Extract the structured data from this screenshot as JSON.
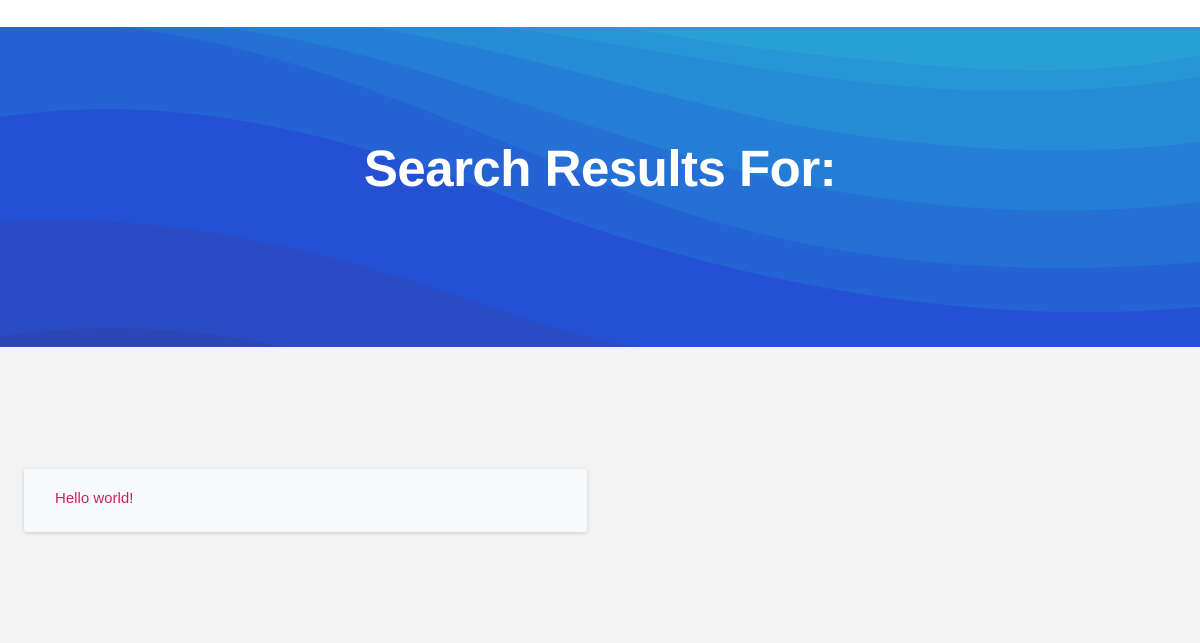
{
  "hero": {
    "title": "Search Results For:"
  },
  "results": [
    {
      "title": "Hello world!"
    }
  ],
  "colors": {
    "hero_primary": "#2451d3",
    "hero_light": "#28a0d6",
    "page_background": "#f3f3f4",
    "card_background": "#f8f9fb",
    "link": "#c8255a"
  }
}
